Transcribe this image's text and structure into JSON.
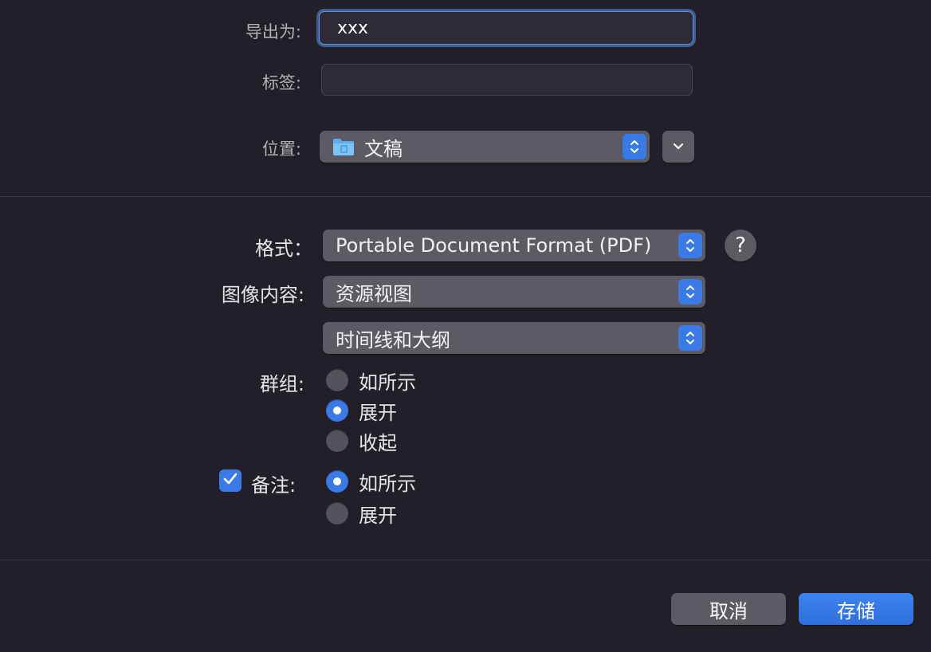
{
  "export": {
    "filename_label": "导出为:",
    "filename_value": "xxx",
    "tags_label": "标签:",
    "tags_value": "",
    "location_label": "位置:",
    "location_value": "文稿"
  },
  "options": {
    "format_label": "格式：",
    "format_value": "Portable Document Format (PDF)",
    "help_label": "?",
    "image_content_label": "图像内容:",
    "image_content_value": "资源视图",
    "image_content_value2": "时间线和大纲",
    "groups_label": "群组:",
    "groups_options": [
      {
        "label": "如所示",
        "selected": false
      },
      {
        "label": "展开",
        "selected": true
      },
      {
        "label": "收起",
        "selected": false
      }
    ],
    "notes_label": "备注:",
    "notes_checked": true,
    "notes_options": [
      {
        "label": "如所示",
        "selected": true
      },
      {
        "label": "展开",
        "selected": false
      }
    ]
  },
  "footer": {
    "cancel_label": "取消",
    "save_label": "存储"
  },
  "colors": {
    "background": "#221f29",
    "accent": "#3a7ae6",
    "control": "#5d5a63"
  },
  "icons": {
    "location": "folder-icon",
    "stepper": "up-down-chevron-icon",
    "expand": "chevron-down-icon",
    "check": "checkmark-icon"
  }
}
